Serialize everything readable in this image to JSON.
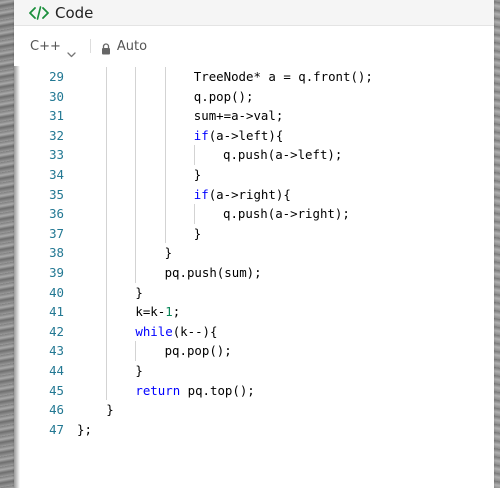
{
  "header": {
    "title": "Code",
    "icon": "code-icon"
  },
  "toolbar": {
    "language": "C++",
    "mode": "Auto",
    "lock_icon": "lock-icon",
    "chevron_icon": "chevron-down-icon"
  },
  "colors": {
    "line_number": "#237893",
    "keyword": "#0000ff",
    "number": "#098658",
    "text": "#000000"
  },
  "editor": {
    "lines": [
      {
        "num": "29",
        "indent": 16,
        "text": "TreeNode* a = q.front();"
      },
      {
        "num": "30",
        "indent": 16,
        "text": "q.pop();"
      },
      {
        "num": "31",
        "indent": 16,
        "text": "sum+=a->val;"
      },
      {
        "num": "32",
        "indent": 16,
        "text": "if(a->left){"
      },
      {
        "num": "33",
        "indent": 20,
        "text": "q.push(a->left);"
      },
      {
        "num": "34",
        "indent": 16,
        "text": "}"
      },
      {
        "num": "35",
        "indent": 16,
        "text": "if(a->right){"
      },
      {
        "num": "36",
        "indent": 20,
        "text": "q.push(a->right);"
      },
      {
        "num": "37",
        "indent": 16,
        "text": "}"
      },
      {
        "num": "38",
        "indent": 12,
        "text": "}"
      },
      {
        "num": "39",
        "indent": 12,
        "text": "pq.push(sum);"
      },
      {
        "num": "40",
        "indent": 8,
        "text": "}"
      },
      {
        "num": "41",
        "indent": 8,
        "text": "k=k-1;"
      },
      {
        "num": "42",
        "indent": 8,
        "text": "while(k--){"
      },
      {
        "num": "43",
        "indent": 12,
        "text": "pq.pop();"
      },
      {
        "num": "44",
        "indent": 8,
        "text": "}"
      },
      {
        "num": "45",
        "indent": 8,
        "text": "return pq.top();"
      },
      {
        "num": "46",
        "indent": 4,
        "text": "}"
      },
      {
        "num": "47",
        "indent": 0,
        "text": "};"
      }
    ]
  }
}
